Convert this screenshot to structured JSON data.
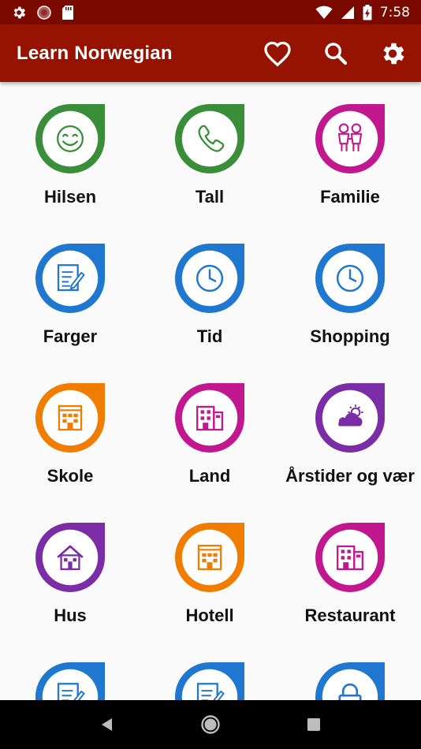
{
  "status_bar": {
    "time": "7:58"
  },
  "app_bar": {
    "title": "Learn Norwegian",
    "actions": [
      {
        "name": "favorites",
        "icon": "heart-outline-icon"
      },
      {
        "name": "search",
        "icon": "search-icon"
      },
      {
        "name": "settings",
        "icon": "gear-icon"
      }
    ]
  },
  "categories": [
    {
      "label": "Hilsen",
      "color": "#3a8e3a",
      "icon": "smiley-icon"
    },
    {
      "label": "Tall",
      "color": "#3a8e3a",
      "icon": "phone-icon"
    },
    {
      "label": "Familie",
      "color": "#c2188f",
      "icon": "family-icon"
    },
    {
      "label": "Farger",
      "color": "#1f77d0",
      "icon": "notepad-icon"
    },
    {
      "label": "Tid",
      "color": "#1f77d0",
      "icon": "clock-icon"
    },
    {
      "label": "Shopping",
      "color": "#1f77d0",
      "icon": "clock-icon"
    },
    {
      "label": "Skole",
      "color": "#f07c00",
      "icon": "building-icon"
    },
    {
      "label": "Land",
      "color": "#c2188f",
      "icon": "office-building-icon"
    },
    {
      "label": "Årstider og vær",
      "color": "#7b2ca7",
      "icon": "weather-icon"
    },
    {
      "label": "Hus",
      "color": "#7b2ca7",
      "icon": "house-icon"
    },
    {
      "label": "Hotell",
      "color": "#f07c00",
      "icon": "building-icon"
    },
    {
      "label": "Restaurant",
      "color": "#c2188f",
      "icon": "office-building-icon"
    },
    {
      "label": "",
      "color": "#1f77d0",
      "icon": "notepad-icon"
    },
    {
      "label": "",
      "color": "#1f77d0",
      "icon": "notepad-icon"
    },
    {
      "label": "",
      "color": "#1f77d0",
      "icon": "lock-icon"
    }
  ],
  "nav_bar": {
    "buttons": [
      {
        "name": "back",
        "icon": "back-triangle-icon"
      },
      {
        "name": "home",
        "icon": "home-circle-icon"
      },
      {
        "name": "recents",
        "icon": "recents-square-icon"
      }
    ]
  }
}
